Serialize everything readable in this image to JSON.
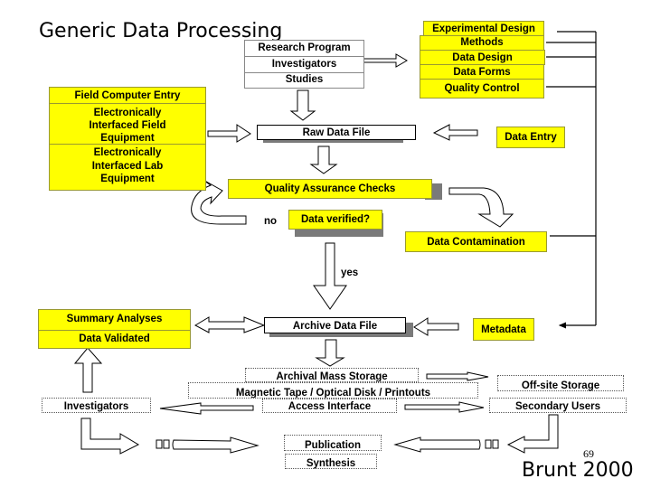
{
  "title": "Generic Data Processing",
  "research_stack": [
    "Research Program",
    "Investigators",
    "Studies"
  ],
  "design_stack": [
    "Experimental Design",
    "Methods",
    "Data Design",
    "Data Forms",
    "Quality Control"
  ],
  "entry_stack": [
    "Field Computer Entry",
    "Electronically Interfaced Field Equipment",
    "Electronically Interfaced Lab Equipment"
  ],
  "raw_data_file": "Raw Data File",
  "data_entry": "Data Entry",
  "qa_checks": "Quality Assurance Checks",
  "no_label": "no",
  "data_verified": "Data verified?",
  "data_contamination": "Data Contamination",
  "yes_label": "yes",
  "summary_stack": [
    "Summary Analyses",
    "Data Validated"
  ],
  "archive_data_file": "Archive Data File",
  "metadata": "Metadata",
  "storage_stack": [
    "Archival Mass Storage",
    "Magnetic Tape / Optical Disk / Printouts",
    "Access Interface"
  ],
  "offsite_storage": "Off-site Storage",
  "secondary_users": "Secondary Users",
  "investigators": "Investigators",
  "publication": "Publication",
  "synthesis": "Synthesis",
  "page_number": "69",
  "citation": "Brunt 2000",
  "colors": {
    "highlight": "#ffff00",
    "shadow": "#7a7a7a"
  }
}
